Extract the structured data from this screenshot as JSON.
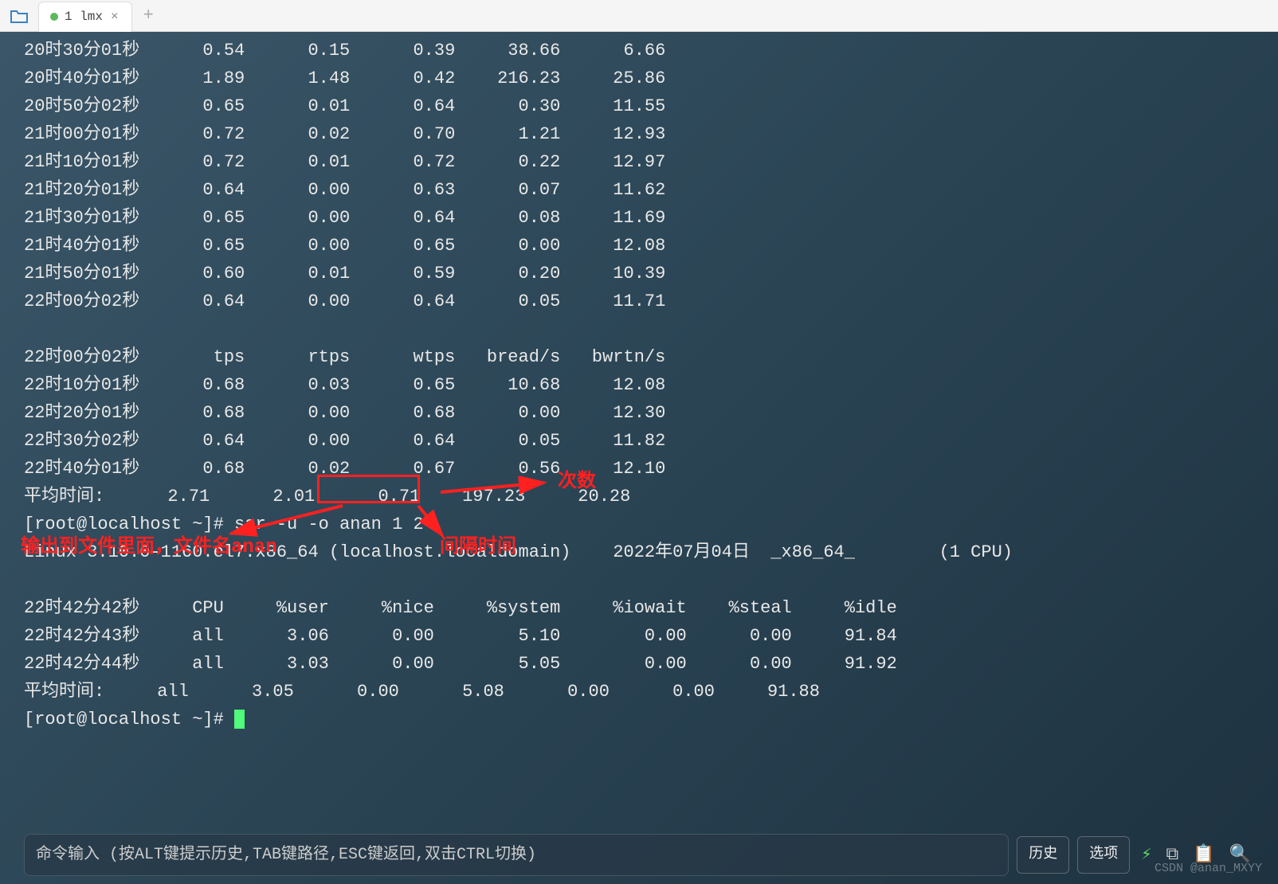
{
  "tab": {
    "label": "1 lmx"
  },
  "sar_rows_1": [
    {
      "t": "20时30分01秒",
      "c1": "0.54",
      "c2": "0.15",
      "c3": "0.39",
      "c4": "38.66",
      "c5": "6.66"
    },
    {
      "t": "20时40分01秒",
      "c1": "1.89",
      "c2": "1.48",
      "c3": "0.42",
      "c4": "216.23",
      "c5": "25.86"
    },
    {
      "t": "20时50分02秒",
      "c1": "0.65",
      "c2": "0.01",
      "c3": "0.64",
      "c4": "0.30",
      "c5": "11.55"
    },
    {
      "t": "21时00分01秒",
      "c1": "0.72",
      "c2": "0.02",
      "c3": "0.70",
      "c4": "1.21",
      "c5": "12.93"
    },
    {
      "t": "21时10分01秒",
      "c1": "0.72",
      "c2": "0.01",
      "c3": "0.72",
      "c4": "0.22",
      "c5": "12.97"
    },
    {
      "t": "21时20分01秒",
      "c1": "0.64",
      "c2": "0.00",
      "c3": "0.63",
      "c4": "0.07",
      "c5": "11.62"
    },
    {
      "t": "21时30分01秒",
      "c1": "0.65",
      "c2": "0.00",
      "c3": "0.64",
      "c4": "0.08",
      "c5": "11.69"
    },
    {
      "t": "21时40分01秒",
      "c1": "0.65",
      "c2": "0.00",
      "c3": "0.65",
      "c4": "0.00",
      "c5": "12.08"
    },
    {
      "t": "21时50分01秒",
      "c1": "0.60",
      "c2": "0.01",
      "c3": "0.59",
      "c4": "0.20",
      "c5": "10.39"
    },
    {
      "t": "22时00分02秒",
      "c1": "0.64",
      "c2": "0.00",
      "c3": "0.64",
      "c4": "0.05",
      "c5": "11.71"
    }
  ],
  "sar_header_2": {
    "t": "22时00分02秒",
    "c1": "tps",
    "c2": "rtps",
    "c3": "wtps",
    "c4": "bread/s",
    "c5": "bwrtn/s"
  },
  "sar_rows_2": [
    {
      "t": "22时10分01秒",
      "c1": "0.68",
      "c2": "0.03",
      "c3": "0.65",
      "c4": "10.68",
      "c5": "12.08"
    },
    {
      "t": "22时20分01秒",
      "c1": "0.68",
      "c2": "0.00",
      "c3": "0.68",
      "c4": "0.00",
      "c5": "12.30"
    },
    {
      "t": "22时30分02秒",
      "c1": "0.64",
      "c2": "0.00",
      "c3": "0.64",
      "c4": "0.05",
      "c5": "11.82"
    },
    {
      "t": "22时40分01秒",
      "c1": "0.68",
      "c2": "0.02",
      "c3": "0.67",
      "c4": "0.56",
      "c5": "12.10"
    }
  ],
  "avg_line": "平均时间:      2.71      2.01      0.71    197.23     20.28",
  "cmd_line": "[root@localhost ~]# sar -u -o anan 1 2",
  "linux_line": "Linux 3.10.0-1160.el7.x86_64 (localhost.localdomain)    2022年07月04日  _x86_64_        (1 CPU)",
  "sar_header_3": {
    "t": "22时42分42秒",
    "c1": "CPU",
    "c2": "%user",
    "c3": "%nice",
    "c4": "%system",
    "c5": "%iowait",
    "c6": "%steal",
    "c7": "%idle"
  },
  "sar_rows_3": [
    {
      "t": "22时42分43秒",
      "c1": "all",
      "c2": "3.06",
      "c3": "0.00",
      "c4": "5.10",
      "c5": "0.00",
      "c6": "0.00",
      "c7": "91.84"
    },
    {
      "t": "22时42分44秒",
      "c1": "all",
      "c2": "3.03",
      "c3": "0.00",
      "c4": "5.05",
      "c5": "0.00",
      "c6": "0.00",
      "c7": "91.92"
    }
  ],
  "avg_line_2": "平均时间:     all      3.05      0.00      5.08      0.00      0.00     91.88",
  "prompt": "[root@localhost ~]# ",
  "annotations": {
    "count": "次数",
    "output_file": "输出到文件里面，文件名anan",
    "interval": "间隔时间"
  },
  "bottom": {
    "hint": "命令输入 (按ALT键提示历史,TAB键路径,ESC键返回,双击CTRL切换)",
    "history": "历史",
    "options": "选项"
  },
  "watermark": "CSDN @anan_MXYY"
}
